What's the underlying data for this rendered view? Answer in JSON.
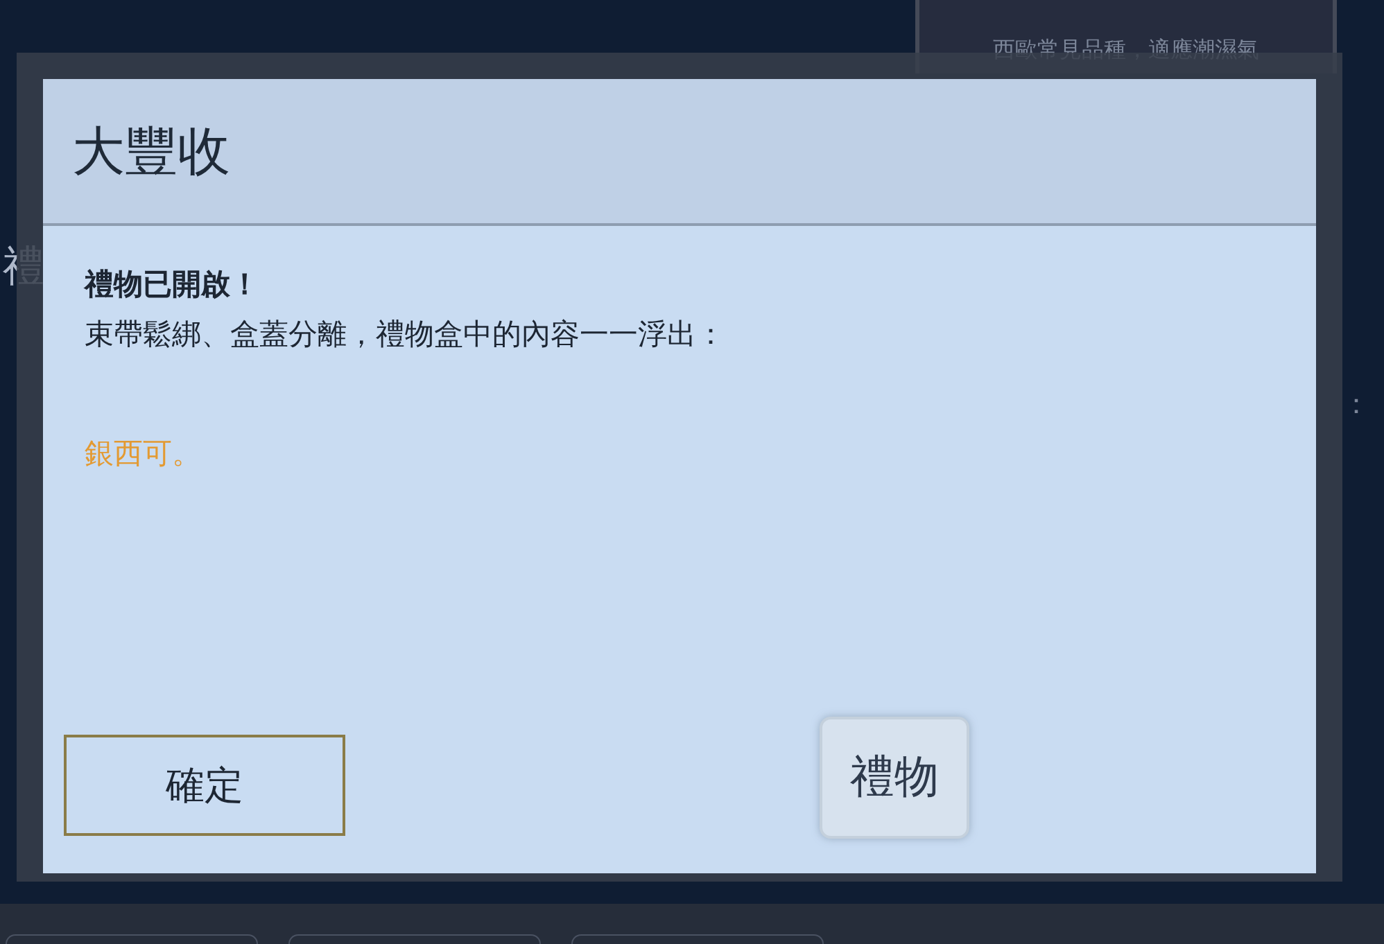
{
  "background": {
    "caption": "西歐常見品種，適應潮濕氣",
    "side_label": "禮",
    "colon": "："
  },
  "dialog": {
    "title": "大豐收",
    "heading": "禮物已開啟！",
    "message": "束帶鬆綁、盒蓋分離，禮物盒中的內容一一浮出：",
    "reward": "銀西可。",
    "buttons": [
      {
        "label": "確定",
        "kind": "confirm"
      },
      {
        "label": "禮物",
        "kind": "gift"
      }
    ]
  }
}
